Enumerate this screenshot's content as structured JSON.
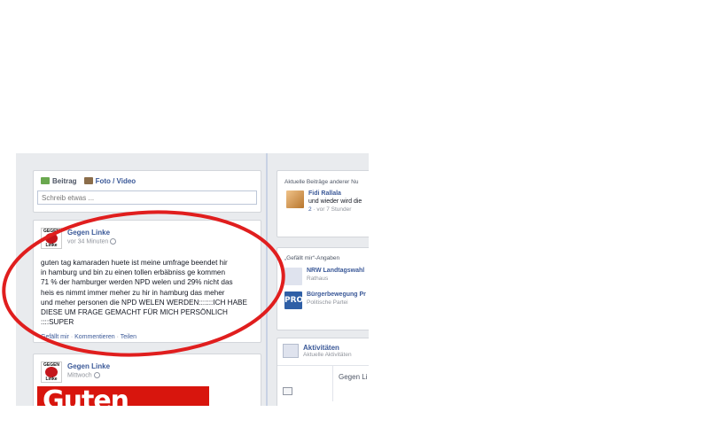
{
  "composer": {
    "tab_status": "Beitrag",
    "tab_photo": "Foto / Video",
    "placeholder": "Schreib etwas ..."
  },
  "post1": {
    "author": "Gegen Linke",
    "time": "vor 34 Minuten",
    "avatar_top": "GEGEN",
    "avatar_bottom": "Linke",
    "lines": [
      "guten tag kamaraden huete ist meine umfrage beendet hir",
      "in hamburg und bin zu einen tollen erbäbniss ge kommen",
      "71 % der hamburger werden NPD welen und 29% nicht das",
      "heis es nimmt immer meher zu hir in hamburg das meher",
      "und meher personen die NPD WELEN WERDEN:::::::ICH HABE",
      "DIESE UM FRAGE GEMACHT FÜR MICH PERSÖNLICH ::::SUPER"
    ],
    "actions": {
      "like": "Gefällt mir",
      "comment": "Kommentieren",
      "share": "Teilen",
      "separator": " · "
    }
  },
  "post2": {
    "author": "Gegen Linke",
    "time": "Mittwoch",
    "avatar_top": "GEGEN",
    "avatar_bottom": "Linke",
    "image_text": "Guten"
  },
  "recent_posts": {
    "title": "Aktuelle Beiträge anderer Nu",
    "item": {
      "name": "Fidi Rallala",
      "text": "und wieder wird die",
      "comments": "2",
      "meta": " · vor 7 Stunder"
    }
  },
  "likes": {
    "title": "„Gefällt mir“-Angaben",
    "items": [
      {
        "name": "NRW Landtagswahl",
        "category": "Rathaus",
        "logo_text": ""
      },
      {
        "name": "Bürgerbewegung Pr",
        "category": "Politische Partei",
        "logo_text": "PRO"
      }
    ]
  },
  "activities": {
    "title": "Aktivitäten",
    "subtitle": "Aktuelle Aktivitäten",
    "preview": "Gegen Li"
  },
  "colors": {
    "link": "#3b5998",
    "annotation_circle": "#e01e1e",
    "page_bg": "#e9ebee"
  }
}
